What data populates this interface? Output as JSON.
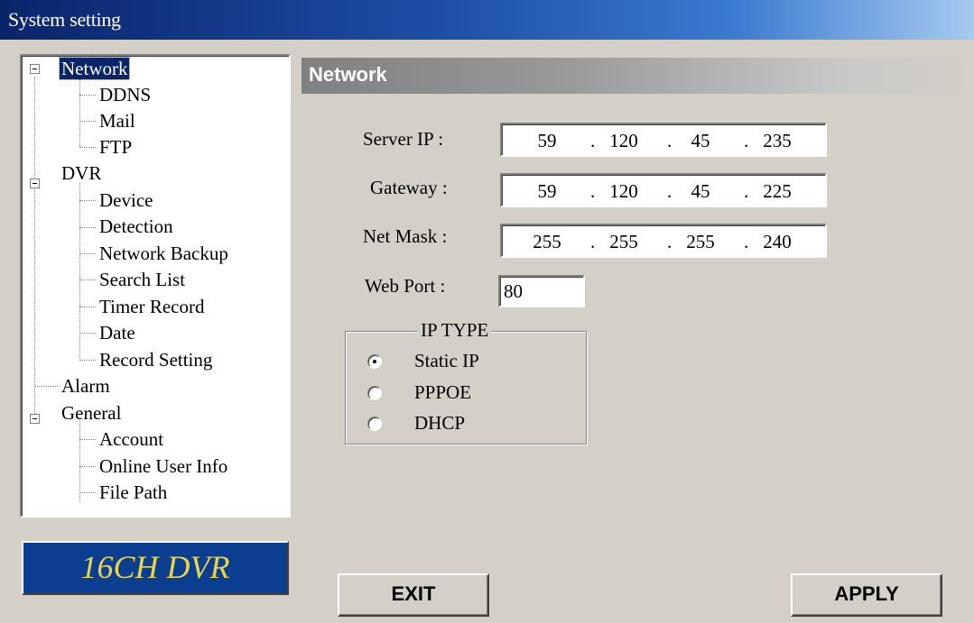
{
  "window": {
    "title": "System setting"
  },
  "tree": {
    "items": [
      {
        "label": "Network"
      },
      {
        "label": "DDNS"
      },
      {
        "label": "Mail"
      },
      {
        "label": "FTP"
      },
      {
        "label": "DVR"
      },
      {
        "label": "Device"
      },
      {
        "label": "Detection"
      },
      {
        "label": "Network Backup"
      },
      {
        "label": "Search List"
      },
      {
        "label": "Timer Record"
      },
      {
        "label": "Date"
      },
      {
        "label": "Record Setting"
      },
      {
        "label": "Alarm"
      },
      {
        "label": "General"
      },
      {
        "label": "Account"
      },
      {
        "label": "Online User Info"
      },
      {
        "label": "File Path"
      }
    ],
    "selected": "Network"
  },
  "logo": {
    "text": "16CH DVR"
  },
  "section": {
    "title": "Network"
  },
  "fields": {
    "server_ip": {
      "label": "Server IP :",
      "octets": [
        "59",
        "120",
        "45",
        "235"
      ]
    },
    "gateway": {
      "label": "Gateway :",
      "octets": [
        "59",
        "120",
        "45",
        "225"
      ]
    },
    "net_mask": {
      "label": "Net Mask :",
      "octets": [
        "255",
        "255",
        "255",
        "240"
      ]
    },
    "web_port": {
      "label": "Web Port :",
      "value": "80"
    },
    "separator": "."
  },
  "ip_type": {
    "legend": "IP TYPE",
    "options": [
      {
        "label": "Static IP",
        "selected": true
      },
      {
        "label": "PPPOE",
        "selected": false
      },
      {
        "label": "DHCP",
        "selected": false
      }
    ]
  },
  "buttons": {
    "exit": "EXIT",
    "apply": "APPLY"
  }
}
